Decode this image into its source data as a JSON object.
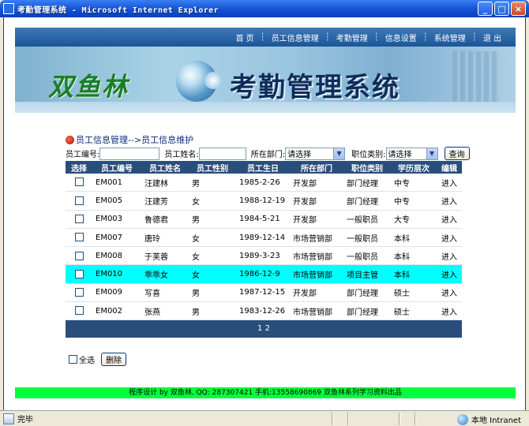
{
  "window": {
    "title": "考勤管理系统 - Microsoft Internet Explorer"
  },
  "nav": {
    "items": [
      "首 页",
      "员工信息管理",
      "考勤管理",
      "信息设置",
      "系统管理",
      "退 出"
    ]
  },
  "banner": {
    "brand": "双鱼林",
    "system_name": "考勤管理系统"
  },
  "breadcrumb": {
    "text": "员工信息管理-->员工信息维护"
  },
  "search": {
    "emp_no_label": "员工编号:",
    "emp_name_label": "员工姓名:",
    "dept_label": "所在部门:",
    "dept_value": "请选择",
    "position_label": "职位类别:",
    "position_value": "请选择",
    "query_button": "查询"
  },
  "table": {
    "headers": [
      "选择",
      "员工编号",
      "员工姓名",
      "员工性别",
      "员工生日",
      "所在部门",
      "职位类别",
      "学历层次",
      "编辑"
    ],
    "rows": [
      [
        "EM001",
        "汪建林",
        "男",
        "1985-2-26",
        "开发部",
        "部门经理",
        "中专",
        "进入"
      ],
      [
        "EM005",
        "汪建芳",
        "女",
        "1988-12-19",
        "开发部",
        "部门经理",
        "中专",
        "进入"
      ],
      [
        "EM003",
        "鲁德君",
        "男",
        "1984-5-21",
        "开发部",
        "一般职员",
        "大专",
        "进入"
      ],
      [
        "EM007",
        "唐玲",
        "女",
        "1989-12-14",
        "市场营销部",
        "一般职员",
        "本科",
        "进入"
      ],
      [
        "EM008",
        "于芙蓉",
        "女",
        "1989-3-23",
        "市场营销部",
        "一般职员",
        "本科",
        "进入"
      ],
      [
        "EM010",
        "乖乖女",
        "女",
        "1986-12-9",
        "市场营销部",
        "项目主管",
        "本科",
        "进入"
      ],
      [
        "EM009",
        "写喜",
        "男",
        "1987-12-15",
        "开发部",
        "部门经理",
        "硕士",
        "进入"
      ],
      [
        "EM002",
        "张燕",
        "男",
        "1983-12-26",
        "市场营销部",
        "部门经理",
        "硕士",
        "进入"
      ]
    ],
    "highlighted_row": 5,
    "pagination": "1 2"
  },
  "actions": {
    "select_all_label": "全选",
    "delete_button": "删除"
  },
  "footer": {
    "text": "程序设计 by 双鱼林, QQ: 287307421 手机:13558690869 双鱼林系列学习资料出品"
  },
  "statusbar": {
    "status": "完毕",
    "zone": "本地 Intranet"
  },
  "colors": {
    "header_bg": "#2a4e7c",
    "highlight_row": "#00ffff",
    "footer_bg": "#00ff3c"
  }
}
